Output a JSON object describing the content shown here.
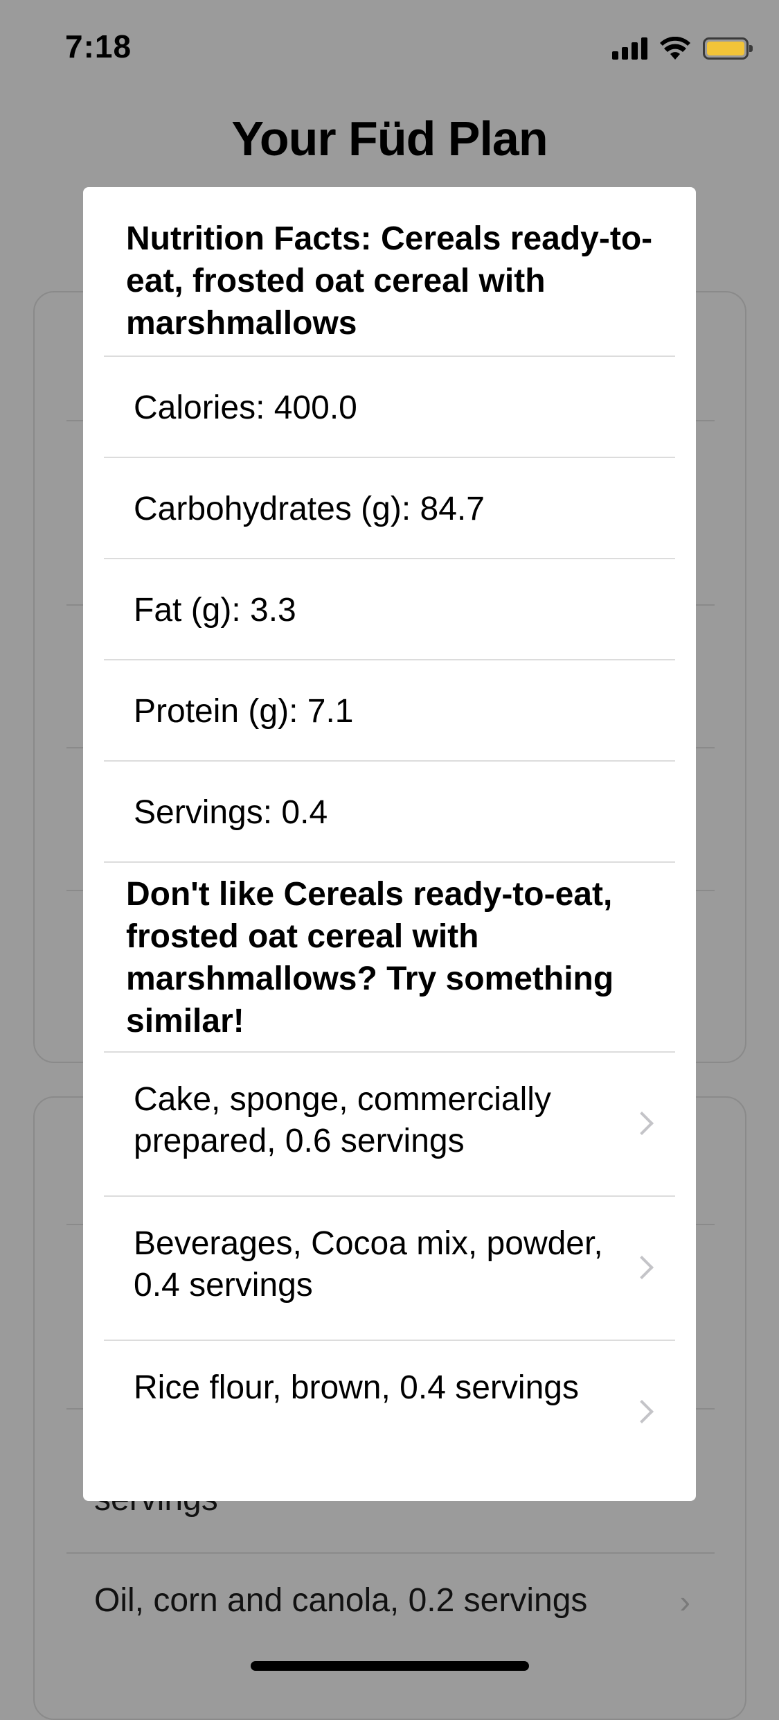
{
  "status_bar": {
    "time": "7:18",
    "icons": [
      "signal-icon",
      "wifi-icon",
      "battery-icon"
    ],
    "battery_color": "#f2c438"
  },
  "page": {
    "title": "Your Füd Plan"
  },
  "background": {
    "visible_rows": [
      {
        "label": "servings"
      },
      {
        "label": "Oil, corn and canola, 0.2 servings"
      }
    ]
  },
  "modal": {
    "nutrition_title": "Nutrition Facts: Cereals ready-to-eat, frosted oat cereal with marshmallows",
    "facts": [
      {
        "label": "Calories: 400.0"
      },
      {
        "label": "Carbohydrates (g): 84.7"
      },
      {
        "label": "Fat (g): 3.3"
      },
      {
        "label": "Protein (g): 7.1"
      },
      {
        "label": "Servings: 0.4"
      }
    ],
    "similar_title": "Don't like Cereals ready-to-eat, frosted oat cereal with marshmallows? Try something similar!",
    "suggestions": [
      {
        "label": "Cake, sponge, commercially prepared, 0.6 servings"
      },
      {
        "label": "Beverages, Cocoa mix, powder, 0.4 servings"
      },
      {
        "label": "Rice flour, brown, 0.4 servings"
      }
    ]
  }
}
